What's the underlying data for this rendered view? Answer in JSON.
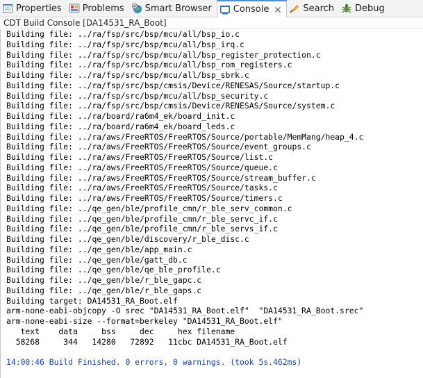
{
  "tabs": [
    {
      "label": "Properties",
      "icon": "properties-icon",
      "active": false
    },
    {
      "label": "Problems",
      "icon": "problems-icon",
      "active": false
    },
    {
      "label": "Smart Browser",
      "icon": "smart-browser-icon",
      "active": false
    },
    {
      "label": "Console",
      "icon": "console-icon",
      "active": true,
      "close": "close-icon"
    },
    {
      "label": "Search",
      "icon": "search-icon",
      "active": false
    },
    {
      "label": "Debug",
      "icon": "debug-icon",
      "active": false
    }
  ],
  "console_title": "CDT Build Console [DA14531_RA_Boot]",
  "console_lines": [
    "Building file: ../ra/fsp/src/bsp/mcu/all/bsp_io.c",
    "Building file: ../ra/fsp/src/bsp/mcu/all/bsp_irq.c",
    "Building file: ../ra/fsp/src/bsp/mcu/all/bsp_register_protection.c",
    "Building file: ../ra/fsp/src/bsp/mcu/all/bsp_rom_registers.c",
    "Building file: ../ra/fsp/src/bsp/mcu/all/bsp_sbrk.c",
    "Building file: ../ra/fsp/src/bsp/cmsis/Device/RENESAS/Source/startup.c",
    "Building file: ../ra/fsp/src/bsp/mcu/all/bsp_security.c",
    "Building file: ../ra/fsp/src/bsp/cmsis/Device/RENESAS/Source/system.c",
    "Building file: ../ra/board/ra6m4_ek/board_init.c",
    "Building file: ../ra/board/ra6m4_ek/board_leds.c",
    "Building file: ../ra/aws/FreeRTOS/FreeRTOS/Source/portable/MemMang/heap_4.c",
    "Building file: ../ra/aws/FreeRTOS/FreeRTOS/Source/event_groups.c",
    "Building file: ../ra/aws/FreeRTOS/FreeRTOS/Source/list.c",
    "Building file: ../ra/aws/FreeRTOS/FreeRTOS/Source/queue.c",
    "Building file: ../ra/aws/FreeRTOS/FreeRTOS/Source/stream_buffer.c",
    "Building file: ../ra/aws/FreeRTOS/FreeRTOS/Source/tasks.c",
    "Building file: ../ra/aws/FreeRTOS/FreeRTOS/Source/timers.c",
    "Building file: ../qe_gen/ble/profile_cmn/r_ble_serv_common.c",
    "Building file: ../qe_gen/ble/profile_cmn/r_ble_servc_if.c",
    "Building file: ../qe_gen/ble/profile_cmn/r_ble_servs_if.c",
    "Building file: ../qe_gen/ble/discovery/r_ble_disc.c",
    "Building file: ../qe_gen/ble/app_main.c",
    "Building file: ../qe_gen/ble/gatt_db.c",
    "Building file: ../qe_gen/ble/qe_ble_profile.c",
    "Building file: ../qe_gen/ble/r_ble_gapc.c",
    "Building file: ../qe_gen/ble/r_ble_gaps.c",
    "Building target: DA14531_RA_Boot.elf",
    "arm-none-eabi-objcopy -O srec \"DA14531_RA_Boot.elf\"  \"DA14531_RA_Boot.srec\"",
    "arm-none-eabi-size --format=berkeley \"DA14531_RA_Boot.elf\"",
    "   text    data     bss     dec     hex filename",
    "  58268     344   14280   72892   11cbc DA14531_RA_Boot.elf",
    "",
    "14:00:46 Build Finished. 0 errors, 0 warnings. (took 5s.462ms)"
  ],
  "colors": {
    "final_line": "#0f3fc8",
    "active_tab_accent": "#4a90d9"
  }
}
